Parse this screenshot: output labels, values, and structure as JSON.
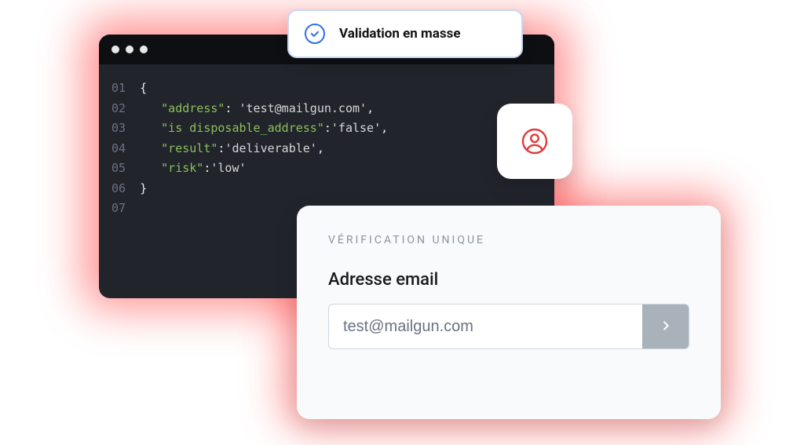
{
  "pill": {
    "label": "Validation en masse"
  },
  "code": {
    "line_numbers": [
      "01",
      "02",
      "03",
      "04",
      "05",
      "06",
      "07"
    ],
    "indent": "   ",
    "open_brace": "{",
    "close_brace": "}",
    "entries": [
      {
        "key": "\"address\"",
        "sep": ": ",
        "value": "'test@mailgun.com'",
        "trail": ","
      },
      {
        "key": "\"is disposable_address\"",
        "sep": ":",
        "value": "'false'",
        "trail": ","
      },
      {
        "key": "\"result\"",
        "sep": ":",
        "value": "'deliverable'",
        "trail": ","
      },
      {
        "key": "\"risk\"",
        "sep": ":",
        "value": "'low'",
        "trail": ""
      }
    ]
  },
  "verify": {
    "eyebrow": "VÉRIFICATION UNIQUE",
    "field_label": "Adresse email",
    "input_value": "test@mailgun.com"
  },
  "icons": {
    "check": "check-icon",
    "avatar": "user-circle-icon",
    "chevron_right": "chevron-right-icon"
  },
  "colors": {
    "accent_red": "#e13b3b",
    "accent_blue": "#2f6fe8",
    "code_bg": "#21242b"
  }
}
